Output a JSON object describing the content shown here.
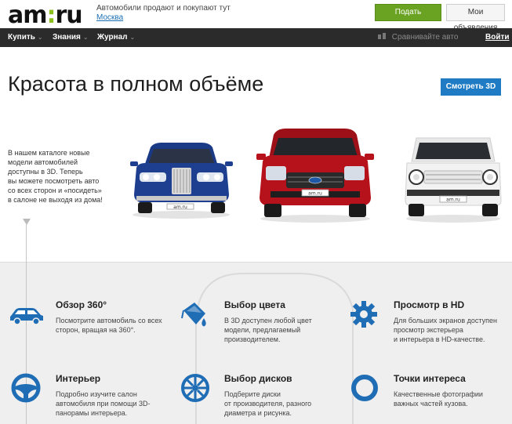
{
  "header": {
    "logo": {
      "left": "am",
      "colon": ":",
      "right": "ru"
    },
    "tagline": "Автомобили продают и покупают тут",
    "city": "Москва",
    "post_button": "Подать объявление",
    "my_ads_button": "Мои объявления"
  },
  "nav": {
    "items": [
      {
        "label": "Купить"
      },
      {
        "label": "Знания"
      },
      {
        "label": "Журнал"
      }
    ],
    "compare": "Сравнивайте авто",
    "login": "Войти"
  },
  "hero": {
    "title": "Красота в полном объёме",
    "view3d_button": "Смотреть 3D",
    "intro_lines": [
      "В нашем каталоге новые",
      "модели автомобилей",
      "доступны в 3D. Теперь",
      "вы можете посмотреть авто",
      "со всех сторон и «посидеть»",
      "в салоне не выходя из дома!"
    ],
    "plate_text": "am.ru"
  },
  "features": [
    {
      "title": "Обзор 360°",
      "desc": [
        "Посмотрите автомобиль со всех",
        "сторон, вращая на 360°."
      ],
      "icon": "car-icon"
    },
    {
      "title": "Выбор цвета",
      "desc": [
        "В 3D доступен любой цвет",
        "модели, предлагаемый",
        "производителем."
      ],
      "icon": "paint-bucket-icon"
    },
    {
      "title": "Просмотр в HD",
      "desc": [
        "Для больших экранов доступен",
        "просмотр экстерьера",
        "и интерьера в HD-качестве."
      ],
      "icon": "gear-icon"
    },
    {
      "title": "Интерьер",
      "desc": [
        "Подробно изучите салон",
        "автомобиля при помощи 3D-",
        "панорамы интерьера."
      ],
      "icon": "steering-wheel-icon"
    },
    {
      "title": "Выбор дисков",
      "desc": [
        "Подберите диски",
        "от производителя, разного",
        "диаметра и рисунка."
      ],
      "icon": "wheel-rim-icon"
    },
    {
      "title": "Точки интереса",
      "desc": [
        "Качественные фотографии",
        "важных частей кузова."
      ],
      "icon": "ring-icon"
    }
  ],
  "colors": {
    "accent_green": "#6aa221",
    "accent_blue": "#1f7cc4",
    "nav_bg": "#2b2b2b",
    "car_blue": "#1e3f8f",
    "car_red": "#b5121b",
    "car_white": "#f2f2f2"
  }
}
